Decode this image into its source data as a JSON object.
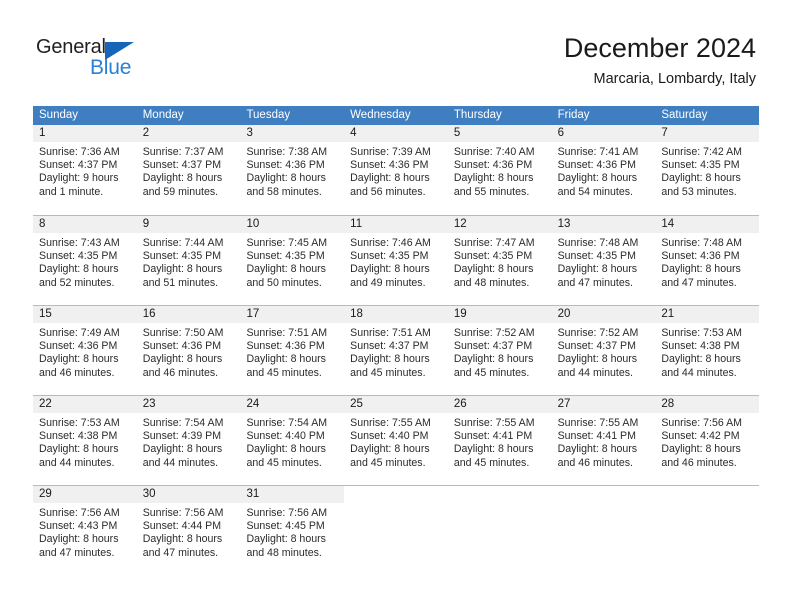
{
  "brand": {
    "name_part1": "General",
    "name_part2": "Blue",
    "accent_color": "#2b7fd4",
    "triangle_color": "#1565b8"
  },
  "header": {
    "title": "December 2024",
    "subtitle": "Marcaria, Lombardy, Italy"
  },
  "calendar": {
    "header_bg": "#3f7fc1",
    "weekdays": [
      "Sunday",
      "Monday",
      "Tuesday",
      "Wednesday",
      "Thursday",
      "Friday",
      "Saturday"
    ],
    "weeks": [
      [
        {
          "day": "1",
          "sunrise": "Sunrise: 7:36 AM",
          "sunset": "Sunset: 4:37 PM",
          "daylight1": "Daylight: 9 hours",
          "daylight2": "and 1 minute."
        },
        {
          "day": "2",
          "sunrise": "Sunrise: 7:37 AM",
          "sunset": "Sunset: 4:37 PM",
          "daylight1": "Daylight: 8 hours",
          "daylight2": "and 59 minutes."
        },
        {
          "day": "3",
          "sunrise": "Sunrise: 7:38 AM",
          "sunset": "Sunset: 4:36 PM",
          "daylight1": "Daylight: 8 hours",
          "daylight2": "and 58 minutes."
        },
        {
          "day": "4",
          "sunrise": "Sunrise: 7:39 AM",
          "sunset": "Sunset: 4:36 PM",
          "daylight1": "Daylight: 8 hours",
          "daylight2": "and 56 minutes."
        },
        {
          "day": "5",
          "sunrise": "Sunrise: 7:40 AM",
          "sunset": "Sunset: 4:36 PM",
          "daylight1": "Daylight: 8 hours",
          "daylight2": "and 55 minutes."
        },
        {
          "day": "6",
          "sunrise": "Sunrise: 7:41 AM",
          "sunset": "Sunset: 4:36 PM",
          "daylight1": "Daylight: 8 hours",
          "daylight2": "and 54 minutes."
        },
        {
          "day": "7",
          "sunrise": "Sunrise: 7:42 AM",
          "sunset": "Sunset: 4:35 PM",
          "daylight1": "Daylight: 8 hours",
          "daylight2": "and 53 minutes."
        }
      ],
      [
        {
          "day": "8",
          "sunrise": "Sunrise: 7:43 AM",
          "sunset": "Sunset: 4:35 PM",
          "daylight1": "Daylight: 8 hours",
          "daylight2": "and 52 minutes."
        },
        {
          "day": "9",
          "sunrise": "Sunrise: 7:44 AM",
          "sunset": "Sunset: 4:35 PM",
          "daylight1": "Daylight: 8 hours",
          "daylight2": "and 51 minutes."
        },
        {
          "day": "10",
          "sunrise": "Sunrise: 7:45 AM",
          "sunset": "Sunset: 4:35 PM",
          "daylight1": "Daylight: 8 hours",
          "daylight2": "and 50 minutes."
        },
        {
          "day": "11",
          "sunrise": "Sunrise: 7:46 AM",
          "sunset": "Sunset: 4:35 PM",
          "daylight1": "Daylight: 8 hours",
          "daylight2": "and 49 minutes."
        },
        {
          "day": "12",
          "sunrise": "Sunrise: 7:47 AM",
          "sunset": "Sunset: 4:35 PM",
          "daylight1": "Daylight: 8 hours",
          "daylight2": "and 48 minutes."
        },
        {
          "day": "13",
          "sunrise": "Sunrise: 7:48 AM",
          "sunset": "Sunset: 4:35 PM",
          "daylight1": "Daylight: 8 hours",
          "daylight2": "and 47 minutes."
        },
        {
          "day": "14",
          "sunrise": "Sunrise: 7:48 AM",
          "sunset": "Sunset: 4:36 PM",
          "daylight1": "Daylight: 8 hours",
          "daylight2": "and 47 minutes."
        }
      ],
      [
        {
          "day": "15",
          "sunrise": "Sunrise: 7:49 AM",
          "sunset": "Sunset: 4:36 PM",
          "daylight1": "Daylight: 8 hours",
          "daylight2": "and 46 minutes."
        },
        {
          "day": "16",
          "sunrise": "Sunrise: 7:50 AM",
          "sunset": "Sunset: 4:36 PM",
          "daylight1": "Daylight: 8 hours",
          "daylight2": "and 46 minutes."
        },
        {
          "day": "17",
          "sunrise": "Sunrise: 7:51 AM",
          "sunset": "Sunset: 4:36 PM",
          "daylight1": "Daylight: 8 hours",
          "daylight2": "and 45 minutes."
        },
        {
          "day": "18",
          "sunrise": "Sunrise: 7:51 AM",
          "sunset": "Sunset: 4:37 PM",
          "daylight1": "Daylight: 8 hours",
          "daylight2": "and 45 minutes."
        },
        {
          "day": "19",
          "sunrise": "Sunrise: 7:52 AM",
          "sunset": "Sunset: 4:37 PM",
          "daylight1": "Daylight: 8 hours",
          "daylight2": "and 45 minutes."
        },
        {
          "day": "20",
          "sunrise": "Sunrise: 7:52 AM",
          "sunset": "Sunset: 4:37 PM",
          "daylight1": "Daylight: 8 hours",
          "daylight2": "and 44 minutes."
        },
        {
          "day": "21",
          "sunrise": "Sunrise: 7:53 AM",
          "sunset": "Sunset: 4:38 PM",
          "daylight1": "Daylight: 8 hours",
          "daylight2": "and 44 minutes."
        }
      ],
      [
        {
          "day": "22",
          "sunrise": "Sunrise: 7:53 AM",
          "sunset": "Sunset: 4:38 PM",
          "daylight1": "Daylight: 8 hours",
          "daylight2": "and 44 minutes."
        },
        {
          "day": "23",
          "sunrise": "Sunrise: 7:54 AM",
          "sunset": "Sunset: 4:39 PM",
          "daylight1": "Daylight: 8 hours",
          "daylight2": "and 44 minutes."
        },
        {
          "day": "24",
          "sunrise": "Sunrise: 7:54 AM",
          "sunset": "Sunset: 4:40 PM",
          "daylight1": "Daylight: 8 hours",
          "daylight2": "and 45 minutes."
        },
        {
          "day": "25",
          "sunrise": "Sunrise: 7:55 AM",
          "sunset": "Sunset: 4:40 PM",
          "daylight1": "Daylight: 8 hours",
          "daylight2": "and 45 minutes."
        },
        {
          "day": "26",
          "sunrise": "Sunrise: 7:55 AM",
          "sunset": "Sunset: 4:41 PM",
          "daylight1": "Daylight: 8 hours",
          "daylight2": "and 45 minutes."
        },
        {
          "day": "27",
          "sunrise": "Sunrise: 7:55 AM",
          "sunset": "Sunset: 4:41 PM",
          "daylight1": "Daylight: 8 hours",
          "daylight2": "and 46 minutes."
        },
        {
          "day": "28",
          "sunrise": "Sunrise: 7:56 AM",
          "sunset": "Sunset: 4:42 PM",
          "daylight1": "Daylight: 8 hours",
          "daylight2": "and 46 minutes."
        }
      ],
      [
        {
          "day": "29",
          "sunrise": "Sunrise: 7:56 AM",
          "sunset": "Sunset: 4:43 PM",
          "daylight1": "Daylight: 8 hours",
          "daylight2": "and 47 minutes."
        },
        {
          "day": "30",
          "sunrise": "Sunrise: 7:56 AM",
          "sunset": "Sunset: 4:44 PM",
          "daylight1": "Daylight: 8 hours",
          "daylight2": "and 47 minutes."
        },
        {
          "day": "31",
          "sunrise": "Sunrise: 7:56 AM",
          "sunset": "Sunset: 4:45 PM",
          "daylight1": "Daylight: 8 hours",
          "daylight2": "and 48 minutes."
        },
        {
          "day": "",
          "sunrise": "",
          "sunset": "",
          "daylight1": "",
          "daylight2": ""
        },
        {
          "day": "",
          "sunrise": "",
          "sunset": "",
          "daylight1": "",
          "daylight2": ""
        },
        {
          "day": "",
          "sunrise": "",
          "sunset": "",
          "daylight1": "",
          "daylight2": ""
        },
        {
          "day": "",
          "sunrise": "",
          "sunset": "",
          "daylight1": "",
          "daylight2": ""
        }
      ]
    ]
  }
}
